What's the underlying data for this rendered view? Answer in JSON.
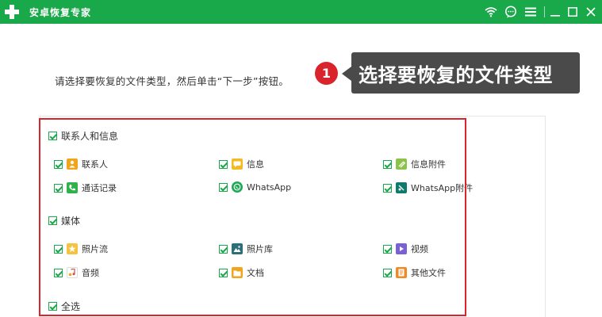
{
  "window": {
    "title": "安卓恢复专家",
    "controls": {
      "wifi_icon": "wifi-icon",
      "chat_icon": "chat-bubble-icon",
      "menu_icon": "hamburger-menu-icon",
      "minimize_icon": "minimize-icon",
      "maximize_icon": "maximize-icon",
      "close_icon": "close-icon"
    }
  },
  "instruction": "请选择要恢复的文件类型，然后单击“下一步”按钮。",
  "annotation": {
    "step_number": "1",
    "callout_text": "选择要恢复的文件类型"
  },
  "groups": {
    "contacts": {
      "label": "联系人和信息",
      "items": [
        {
          "label": "联系人",
          "icon": "contacts-icon",
          "color": "#f2a51c"
        },
        {
          "label": "信息",
          "icon": "message-icon",
          "color": "#f5b921"
        },
        {
          "label": "信息附件",
          "icon": "attachment-icon",
          "color": "#8bc34a"
        },
        {
          "label": "通话记录",
          "icon": "phone-icon",
          "color": "#2fb24a"
        },
        {
          "label": "WhatsApp",
          "icon": "whatsapp-icon",
          "color": "#1fa855"
        },
        {
          "label": "WhatsApp附件",
          "icon": "whatsapp-attachment-icon",
          "color": "#0d7c6b"
        }
      ]
    },
    "media": {
      "label": "媒体",
      "items": [
        {
          "label": "照片流",
          "icon": "photo-stream-icon",
          "color": "#f5c242"
        },
        {
          "label": "照片库",
          "icon": "photo-library-icon",
          "color": "#2b6f7a"
        },
        {
          "label": "视频",
          "icon": "video-icon",
          "color": "#7b5fd6"
        },
        {
          "label": "音频",
          "icon": "audio-icon",
          "color": "#d84a4a"
        },
        {
          "label": "文档",
          "icon": "document-icon",
          "color": "#f0a51e"
        },
        {
          "label": "其他文件",
          "icon": "other-files-icon",
          "color": "#f08a24"
        }
      ]
    }
  },
  "select_all": "全选",
  "colors": {
    "titlebar": "#19a84a",
    "accent_red": "#d8242a",
    "callout_bg": "#4a4a4a"
  }
}
